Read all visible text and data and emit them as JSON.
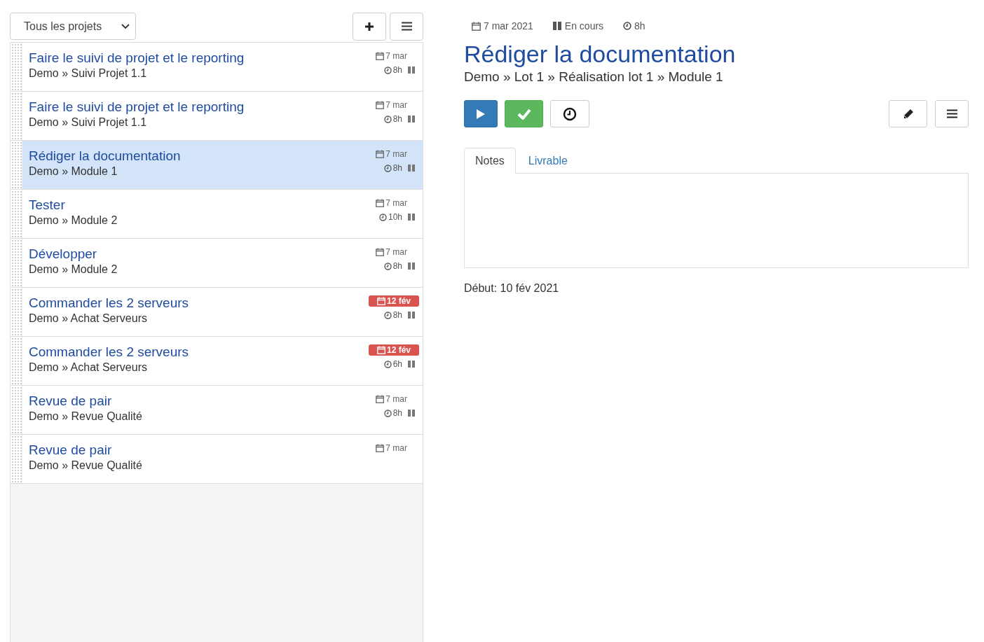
{
  "project_filter": {
    "value": "Tous les projets"
  },
  "tasks": [
    {
      "title": "Faire le suivi de projet et le reporting",
      "path": "Demo » Suivi Projet 1.1",
      "date": "7 mar",
      "overdue": false,
      "hours": "8h",
      "status_icon": true,
      "selected": false
    },
    {
      "title": "Faire le suivi de projet et le reporting",
      "path": "Demo » Suivi Projet 1.1",
      "date": "7 mar",
      "overdue": false,
      "hours": "8h",
      "status_icon": true,
      "selected": false
    },
    {
      "title": "Rédiger la documentation",
      "path": "Demo » Module 1",
      "date": "7 mar",
      "overdue": false,
      "hours": "8h",
      "status_icon": true,
      "selected": true
    },
    {
      "title": "Tester",
      "path": "Demo » Module 2",
      "date": "7 mar",
      "overdue": false,
      "hours": "10h",
      "status_icon": true,
      "selected": false
    },
    {
      "title": "Développer",
      "path": "Demo » Module 2",
      "date": "7 mar",
      "overdue": false,
      "hours": "8h",
      "status_icon": true,
      "selected": false
    },
    {
      "title": "Commander les 2 serveurs",
      "path": "Demo » Achat Serveurs",
      "date": "12 fév",
      "overdue": true,
      "hours": "8h",
      "status_icon": true,
      "selected": false
    },
    {
      "title": "Commander les 2 serveurs",
      "path": "Demo » Achat Serveurs",
      "date": "12 fév",
      "overdue": true,
      "hours": "6h",
      "status_icon": true,
      "selected": false
    },
    {
      "title": "Revue de pair",
      "path": "Demo » Revue Qualité",
      "date": "7 mar",
      "overdue": false,
      "hours": "8h",
      "status_icon": true,
      "selected": false
    },
    {
      "title": "Revue de pair",
      "path": "Demo » Revue Qualité",
      "date": "7 mar",
      "overdue": false,
      "status_icon": false,
      "selected": false
    }
  ],
  "detail": {
    "date": "7 mar 2021",
    "status": "En cours",
    "hours": "8h",
    "title": "Rédiger la documentation",
    "path": "Demo » Lot 1 » Réalisation lot 1 » Module 1",
    "tabs": [
      {
        "label": "Notes",
        "selected": true
      },
      {
        "label": "Livrable",
        "selected": false
      }
    ],
    "start": "Début: 10 fév 2021"
  }
}
